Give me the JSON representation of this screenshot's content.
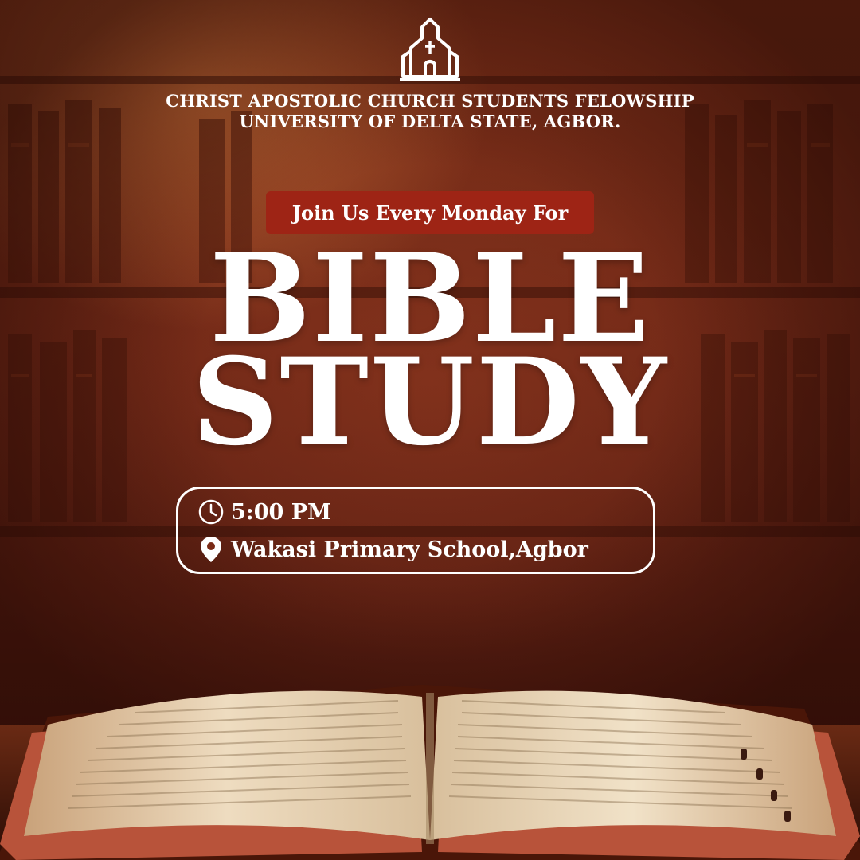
{
  "organization": {
    "line1": "CHRIST APOSTOLIC CHURCH STUDENTS FELOWSHIP",
    "line2": "UNIVERSITY OF DELTA STATE, AGBOR."
  },
  "invite": "Join Us Every Monday For",
  "title": {
    "line1": "BIBLE",
    "line2": "STUDY"
  },
  "details": {
    "time": "5:00 PM",
    "location": "Wakasi Primary School,Agbor"
  },
  "icons": {
    "logo": "church-icon",
    "time": "clock-icon",
    "location": "location-pin-icon"
  },
  "colors": {
    "background": "#6e2716",
    "pill": "#9e2415",
    "text": "#ffffff"
  }
}
